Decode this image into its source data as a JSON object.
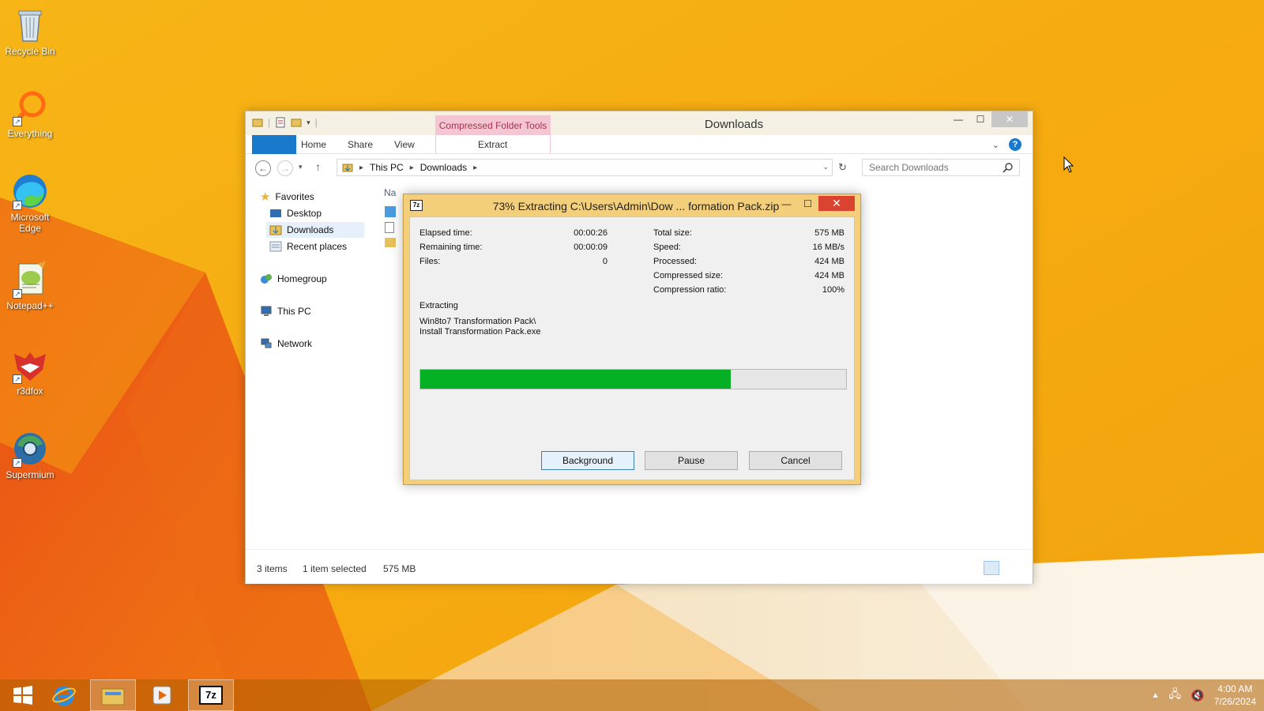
{
  "colors": {
    "wallpaper_base": "#f5a90f",
    "wallpaper_red": "#e5451b",
    "ribbon_accent": "#1979ca",
    "context_tab_bg": "#f4c6d4",
    "context_tab_text": "#a7334f",
    "dialog_frame": "#f4cf7b",
    "progress_green": "#06b025",
    "close_red": "#d9432f"
  },
  "desktop": {
    "icons": [
      {
        "label": "Recycle Bin",
        "icon": "recycle-bin-icon"
      },
      {
        "label": "Everything",
        "icon": "everything-search-icon"
      },
      {
        "label": "Microsoft Edge",
        "icon": "edge-icon"
      },
      {
        "label": "Notepad++",
        "icon": "notepad-plus-plus-icon"
      },
      {
        "label": "r3dfox",
        "icon": "r3dfox-icon"
      },
      {
        "label": "Supermium",
        "icon": "supermium-icon"
      }
    ]
  },
  "explorer": {
    "title": "Downloads",
    "context_tab_group": "Compressed Folder Tools",
    "ribbon_tabs": [
      "Home",
      "Share",
      "View"
    ],
    "context_tab": "Extract",
    "breadcrumb": [
      "This PC",
      "Downloads"
    ],
    "search_placeholder": "Search Downloads",
    "nav": {
      "favorites": "Favorites",
      "desktop": "Desktop",
      "downloads": "Downloads",
      "recent": "Recent places",
      "homegroup": "Homegroup",
      "this_pc": "This PC",
      "network": "Network"
    },
    "column_header_partial": "Na",
    "status": {
      "items": "3 items",
      "selected": "1 item selected",
      "size": "575 MB"
    }
  },
  "dialog": {
    "title": "73% Extracting C:\\Users\\Admin\\Dow ... formation Pack.zip",
    "progress_percent": 73,
    "left_stats": [
      {
        "label": "Elapsed time:",
        "value": "00:00:26"
      },
      {
        "label": "Remaining time:",
        "value": "00:00:09"
      },
      {
        "label": "Files:",
        "value": "0"
      }
    ],
    "right_stats": [
      {
        "label": "Total size:",
        "value": "575 MB"
      },
      {
        "label": "Speed:",
        "value": "16 MB/s"
      },
      {
        "label": "Processed:",
        "value": "424 MB"
      },
      {
        "label": "Compressed size:",
        "value": "424 MB"
      },
      {
        "label": "Compression ratio:",
        "value": "100%"
      }
    ],
    "operation": "Extracting",
    "current_path_line1": "Win8to7 Transformation Pack\\",
    "current_path_line2": "Install Transformation Pack.exe",
    "buttons": {
      "background": "Background",
      "pause": "Pause",
      "cancel": "Cancel"
    },
    "app_badge": "7z"
  },
  "taskbar": {
    "items": [
      "start-icon",
      "internet-explorer-icon",
      "file-explorer-icon",
      "media-player-icon",
      "7zip-icon"
    ],
    "app_badge": "7z",
    "time": "4:00 AM",
    "date": "7/26/2024"
  }
}
